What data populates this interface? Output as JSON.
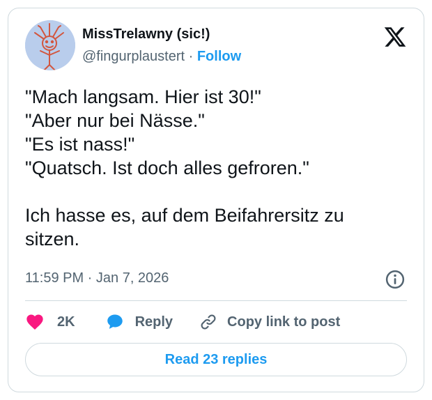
{
  "author": {
    "name": "MissTrelawny (sic!)",
    "handle": "@fingurplaustert",
    "separator": "·",
    "follow_label": "Follow",
    "avatar_icon": "stick-figure-drawing-icon"
  },
  "platform": {
    "logo_icon": "x-logo-icon"
  },
  "tweet": {
    "lines": [
      "\"Mach langsam. Hier ist 30!\"",
      "\"Aber nur bei Nässe.\"",
      "\"Es ist nass!\"",
      "\"Quatsch. Ist doch alles gefroren.\"",
      "",
      "Ich hasse es, auf dem Beifahrersitz zu sitzen."
    ],
    "timestamp": "11:59 PM · Jan 7, 2026"
  },
  "actions": {
    "like_count": "2K",
    "reply_label": "Reply",
    "copy_label": "Copy link to post"
  },
  "footer": {
    "read_replies_label": "Read 23 replies"
  },
  "colors": {
    "accent": "#1d9bf0",
    "like": "#f91880",
    "text": "#0f1419",
    "muted": "#536471",
    "border": "#cfd9de"
  }
}
